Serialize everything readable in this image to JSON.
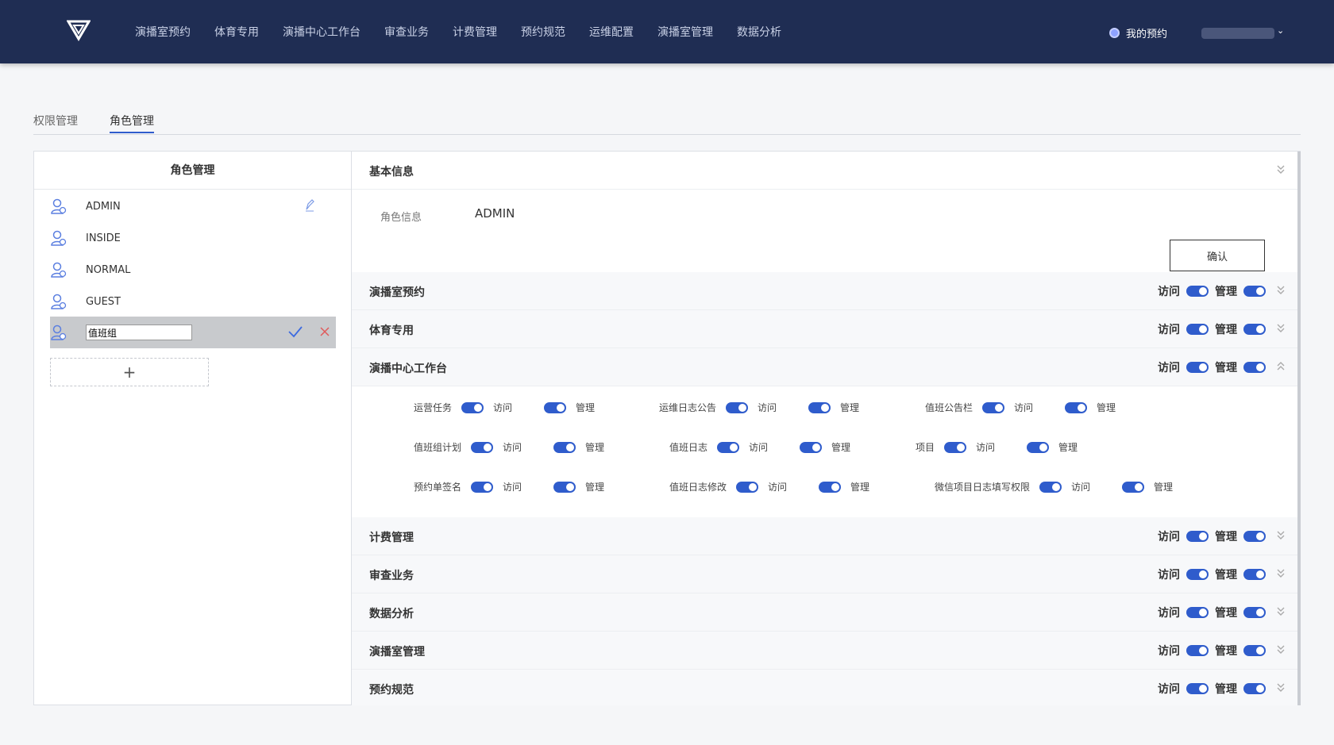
{
  "header": {
    "nav": [
      "演播室预约",
      "体育专用",
      "演播中心工作台",
      "审查业务",
      "计费管理",
      "预约规范",
      "运维配置",
      "演播室管理",
      "数据分析"
    ],
    "my_reservation": "我的预约",
    "user_caret": "⌄"
  },
  "tabs": {
    "permission": "权限管理",
    "role": "角色管理"
  },
  "left": {
    "title": "角色管理",
    "roles": [
      "ADMIN",
      "INSIDE",
      "NORMAL",
      "GUEST"
    ],
    "editing_value": "值班组",
    "add": "+"
  },
  "right": {
    "basic": {
      "title": "基本信息",
      "role_info_label": "角色信息",
      "role_info_value": "ADMIN",
      "confirm": "确认"
    },
    "visit": "访问",
    "manage": "管理",
    "sections": [
      "演播室预约",
      "体育专用",
      "演播中心工作台",
      "计费管理",
      "审查业务",
      "数据分析",
      "演播室管理",
      "预约规范"
    ],
    "sub_items": [
      "运营任务",
      "运维日志公告",
      "值班公告栏",
      "值班组计划",
      "值班日志",
      "项目",
      "预约单签名",
      "值班日志修改",
      "微信项目日志填写权限"
    ]
  }
}
